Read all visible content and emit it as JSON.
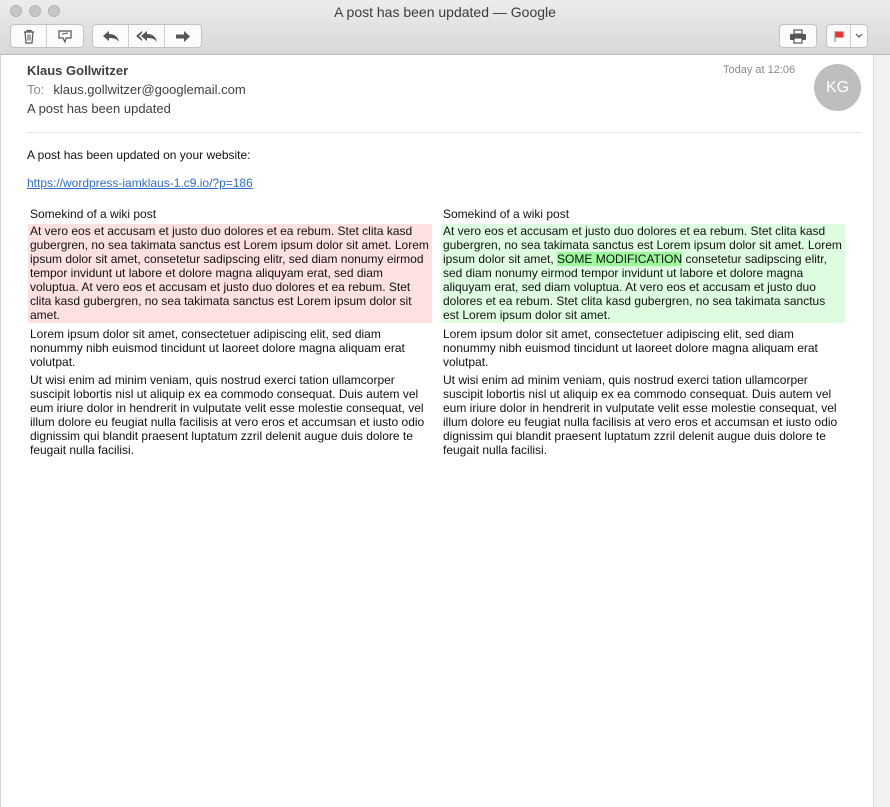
{
  "window": {
    "title": "A post has been updated — Google"
  },
  "toolbar": {
    "buttons": [
      "trash-icon",
      "junk-icon",
      "reply-icon",
      "reply-all-icon",
      "forward-icon",
      "print-icon",
      "flag-icon",
      "chevron-down-icon"
    ],
    "flag_color": "#e8372c"
  },
  "message": {
    "sender": "Klaus Gollwitzer",
    "to_label": "To:",
    "to_address": "klaus.gollwitzer@googlemail.com",
    "subject": "A post has been updated",
    "date": "Today at 12:06",
    "avatar_initials": "KG"
  },
  "body": {
    "intro": "A post has been updated on your website:",
    "link": "https://wordpress-iamklaus-1.c9.io/?p=186",
    "left": {
      "title": "Somekind of a wiki post",
      "removed": "At vero eos et accusam et justo duo dolores et ea rebum. Stet clita kasd gubergren, no sea takimata sanctus est Lorem ipsum dolor sit amet. Lorem ipsum dolor sit amet, consetetur sadipscing elitr, sed diam nonumy eirmod tempor invidunt ut labore et dolore magna aliquyam erat, sed diam voluptua. At vero eos et accusam et justo duo dolores et ea rebum. Stet clita kasd gubergren, no sea takimata sanctus est Lorem ipsum dolor sit amet.",
      "para2": "Lorem ipsum dolor sit amet, consectetuer adipiscing elit, sed diam nonummy nibh euismod tincidunt ut laoreet dolore magna aliquam erat volutpat.",
      "para3": "Ut wisi enim ad minim veniam, quis nostrud exerci tation ullamcorper suscipit lobortis nisl ut aliquip ex ea commodo consequat. Duis autem vel eum iriure dolor in hendrerit in vulputate velit esse molestie consequat, vel illum dolore eu feugiat nulla facilisis at vero eros et accumsan et iusto odio dignissim qui blandit praesent luptatum zzril delenit augue duis dolore te feugait nulla facilisi."
    },
    "right": {
      "title": "Somekind of a wiki post",
      "added_before": "At vero eos et accusam et justo duo dolores et ea rebum. Stet clita kasd gubergren, no sea takimata sanctus est Lorem ipsum dolor sit amet. Lorem ipsum dolor sit amet, ",
      "added_mark": "SOME MODIFICATION",
      "added_after": " consetetur sadipscing elitr, sed diam nonumy eirmod tempor invidunt ut labore et dolore magna aliquyam erat, sed diam voluptua. At vero eos et accusam et justo duo dolores et ea rebum. Stet clita kasd gubergren, no sea takimata sanctus est Lorem ipsum dolor sit amet.",
      "para2": "Lorem ipsum dolor sit amet, consectetuer adipiscing elit, sed diam nonummy nibh euismod tincidunt ut laoreet dolore magna aliquam erat volutpat.",
      "para3": "Ut wisi enim ad minim veniam, quis nostrud exerci tation ullamcorper suscipit lobortis nisl ut aliquip ex ea commodo consequat. Duis autem vel eum iriure dolor in hendrerit in vulputate velit esse molestie consequat, vel illum dolore eu feugiat nulla facilisis at vero eros et accumsan et iusto odio dignissim qui blandit praesent luptatum zzril delenit augue duis dolore te feugait nulla facilisi."
    }
  }
}
